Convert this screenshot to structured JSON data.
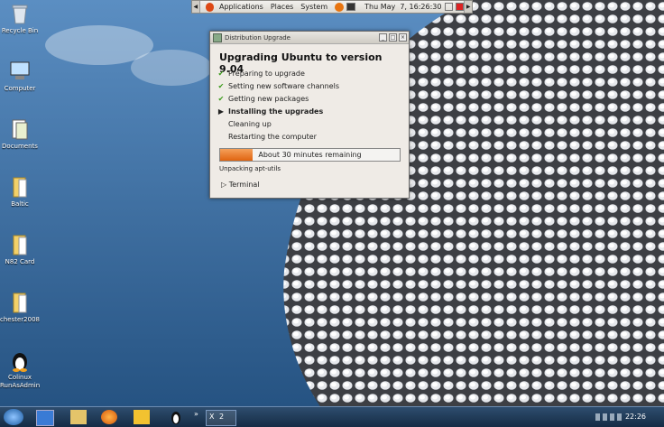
{
  "desktop": {
    "icons": [
      {
        "label": "Recycle Bin",
        "icon": "recycle-bin-icon"
      },
      {
        "label": "Computer",
        "icon": "computer-icon"
      },
      {
        "label": "Documents",
        "icon": "documents-icon"
      },
      {
        "label": "Baltic",
        "icon": "folder-icon"
      },
      {
        "label": "N82 Card",
        "icon": "folder-icon"
      },
      {
        "label": "chester2008",
        "icon": "folder-icon"
      },
      {
        "label": "Colinux RunAsAdmin",
        "icon": "tux-icon"
      }
    ]
  },
  "gnome_panel": {
    "menus": [
      "Applications",
      "Places",
      "System"
    ],
    "clock": "Thu May  7, 16:26:30"
  },
  "dialog": {
    "title": "Distribution Upgrade",
    "heading": "Upgrading Ubuntu to version 9.04",
    "steps": [
      {
        "label": "Preparing to upgrade",
        "state": "done"
      },
      {
        "label": "Setting new software channels",
        "state": "done"
      },
      {
        "label": "Getting new packages",
        "state": "done"
      },
      {
        "label": "Installing the upgrades",
        "state": "current"
      },
      {
        "label": "Cleaning up",
        "state": "pending"
      },
      {
        "label": "Restarting the computer",
        "state": "pending"
      }
    ],
    "progress": {
      "text": "About 30 minutes remaining",
      "fraction": 0.18
    },
    "status": "Unpacking apt-utils",
    "terminal_label": "Terminal"
  },
  "taskbar": {
    "window_count": "2",
    "clock": "22:26"
  },
  "colors": {
    "progress_fill": "#e06410",
    "check": "#3a9a1a"
  }
}
